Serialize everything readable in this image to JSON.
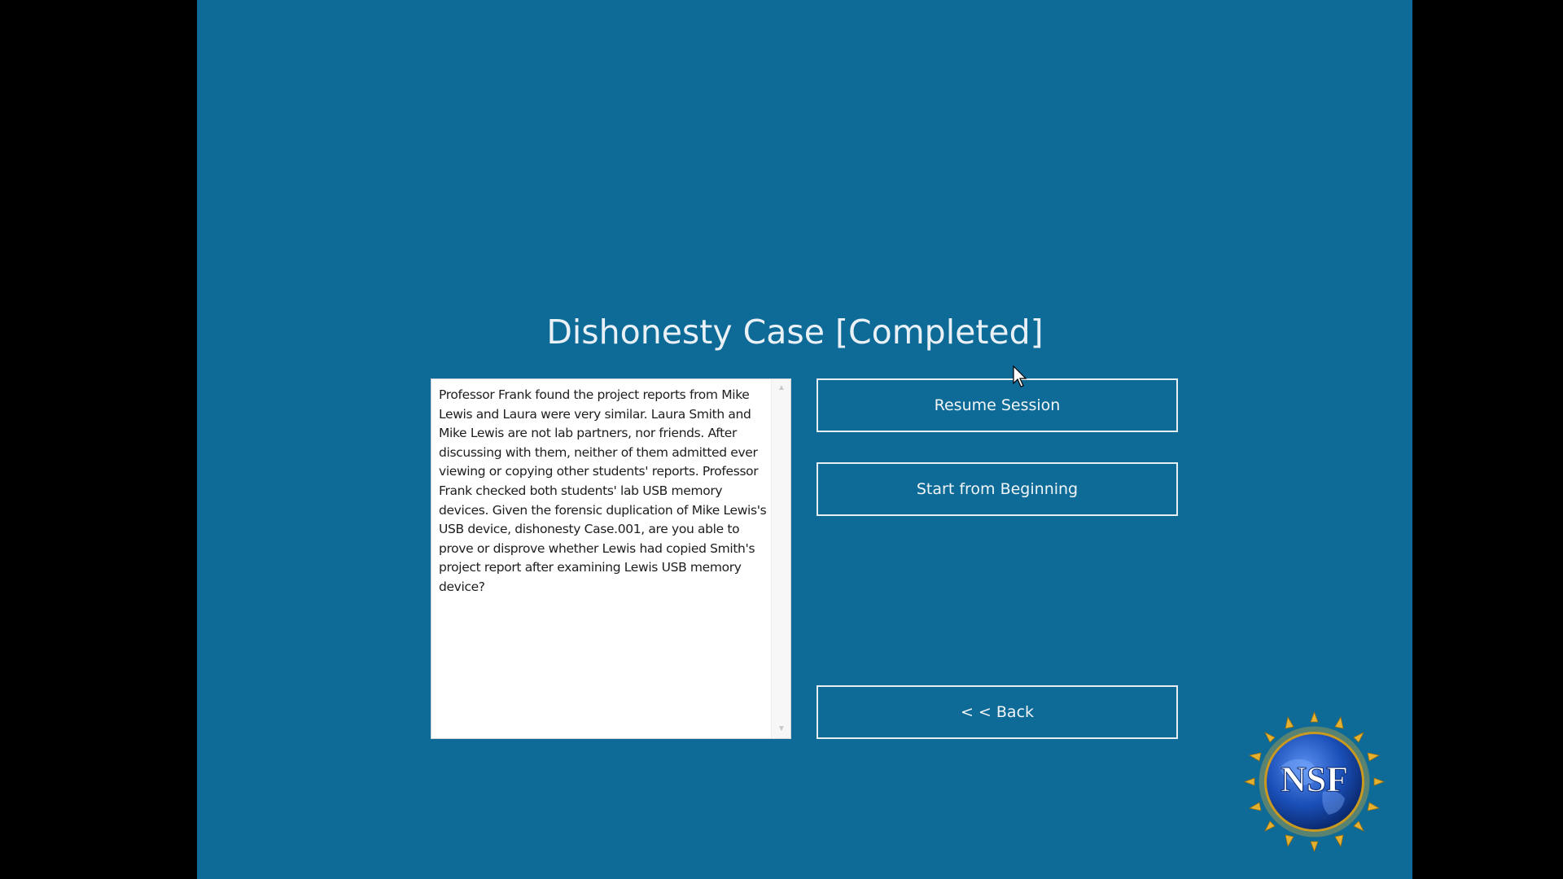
{
  "page": {
    "title": "Dishonesty Case [Completed]"
  },
  "case_description": "Professor Frank found the project reports from Mike Lewis and Laura were very similar. Laura Smith and Mike Lewis are not lab partners, nor friends. After discussing with them, neither of them admitted ever viewing or copying other students' reports. Professor Frank checked both students' lab USB memory devices. Given the forensic duplication of Mike Lewis's USB device, dishonesty Case.001, are you able to prove or disprove whether Lewis had copied Smith's project report after examining Lewis USB memory device?",
  "buttons": {
    "resume": "Resume Session",
    "start": "Start from Beginning",
    "back": "< < Back"
  },
  "logo": {
    "text": "NSF",
    "icon": "nsf-logo-icon"
  },
  "colors": {
    "background": "#0e6a96",
    "outer_background": "#000000",
    "text_light": "#e9f1f6",
    "logo_gold": "#e3b02f",
    "logo_blue": "#1a4fb8"
  }
}
